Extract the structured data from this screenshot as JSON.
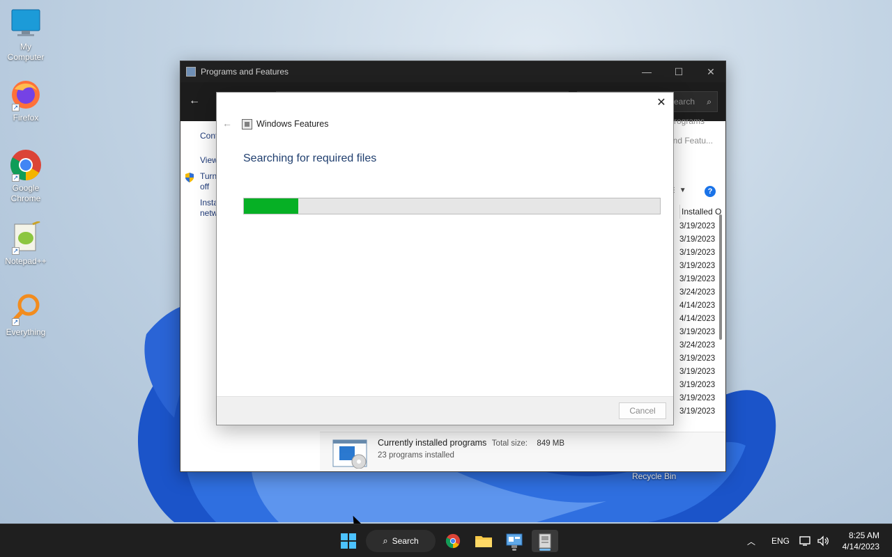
{
  "desktop": {
    "icons": [
      {
        "label": "My Computer",
        "icon": "monitor-icon"
      },
      {
        "label": "Firefox",
        "icon": "firefox-icon"
      },
      {
        "label": "Google Chrome",
        "icon": "chrome-icon"
      },
      {
        "label": "Notepad++",
        "icon": "notepadplusplus-icon"
      },
      {
        "label": "Everything",
        "icon": "everything-search-icon"
      }
    ],
    "recycle_bin_label": "Recycle Bin"
  },
  "programs_window": {
    "title": "Programs and Features",
    "search_placeholder": "Search Programs and Featu...",
    "left_links": [
      "Cont",
      "View",
      "Turn",
      "off",
      "Insta",
      "netw"
    ],
    "column_header": "Installed On",
    "install_dates": [
      "3/19/2023",
      "3/19/2023",
      "3/19/2023",
      "3/19/2023",
      "3/19/2023",
      "3/24/2023",
      "4/14/2023",
      "4/14/2023",
      "3/19/2023",
      "3/24/2023",
      "3/19/2023",
      "3/19/2023",
      "3/19/2023",
      "3/19/2023",
      "3/19/2023"
    ],
    "footer": {
      "title": "Currently installed programs",
      "total_size_label": "Total size:",
      "total_size_value": "849 MB",
      "count_text": "23 programs installed"
    }
  },
  "windows_features_dialog": {
    "title": "Windows Features",
    "heading": "Searching for required files",
    "progress_percent": 13,
    "cancel_label": "Cancel"
  },
  "taskbar": {
    "search_label": "Search",
    "language": "ENG",
    "time": "8:25 AM",
    "date": "4/14/2023"
  },
  "colors": {
    "progress_fill": "#06b025",
    "heading_blue": "#1f3e6e",
    "taskbar_bg": "#1f1f1f"
  }
}
